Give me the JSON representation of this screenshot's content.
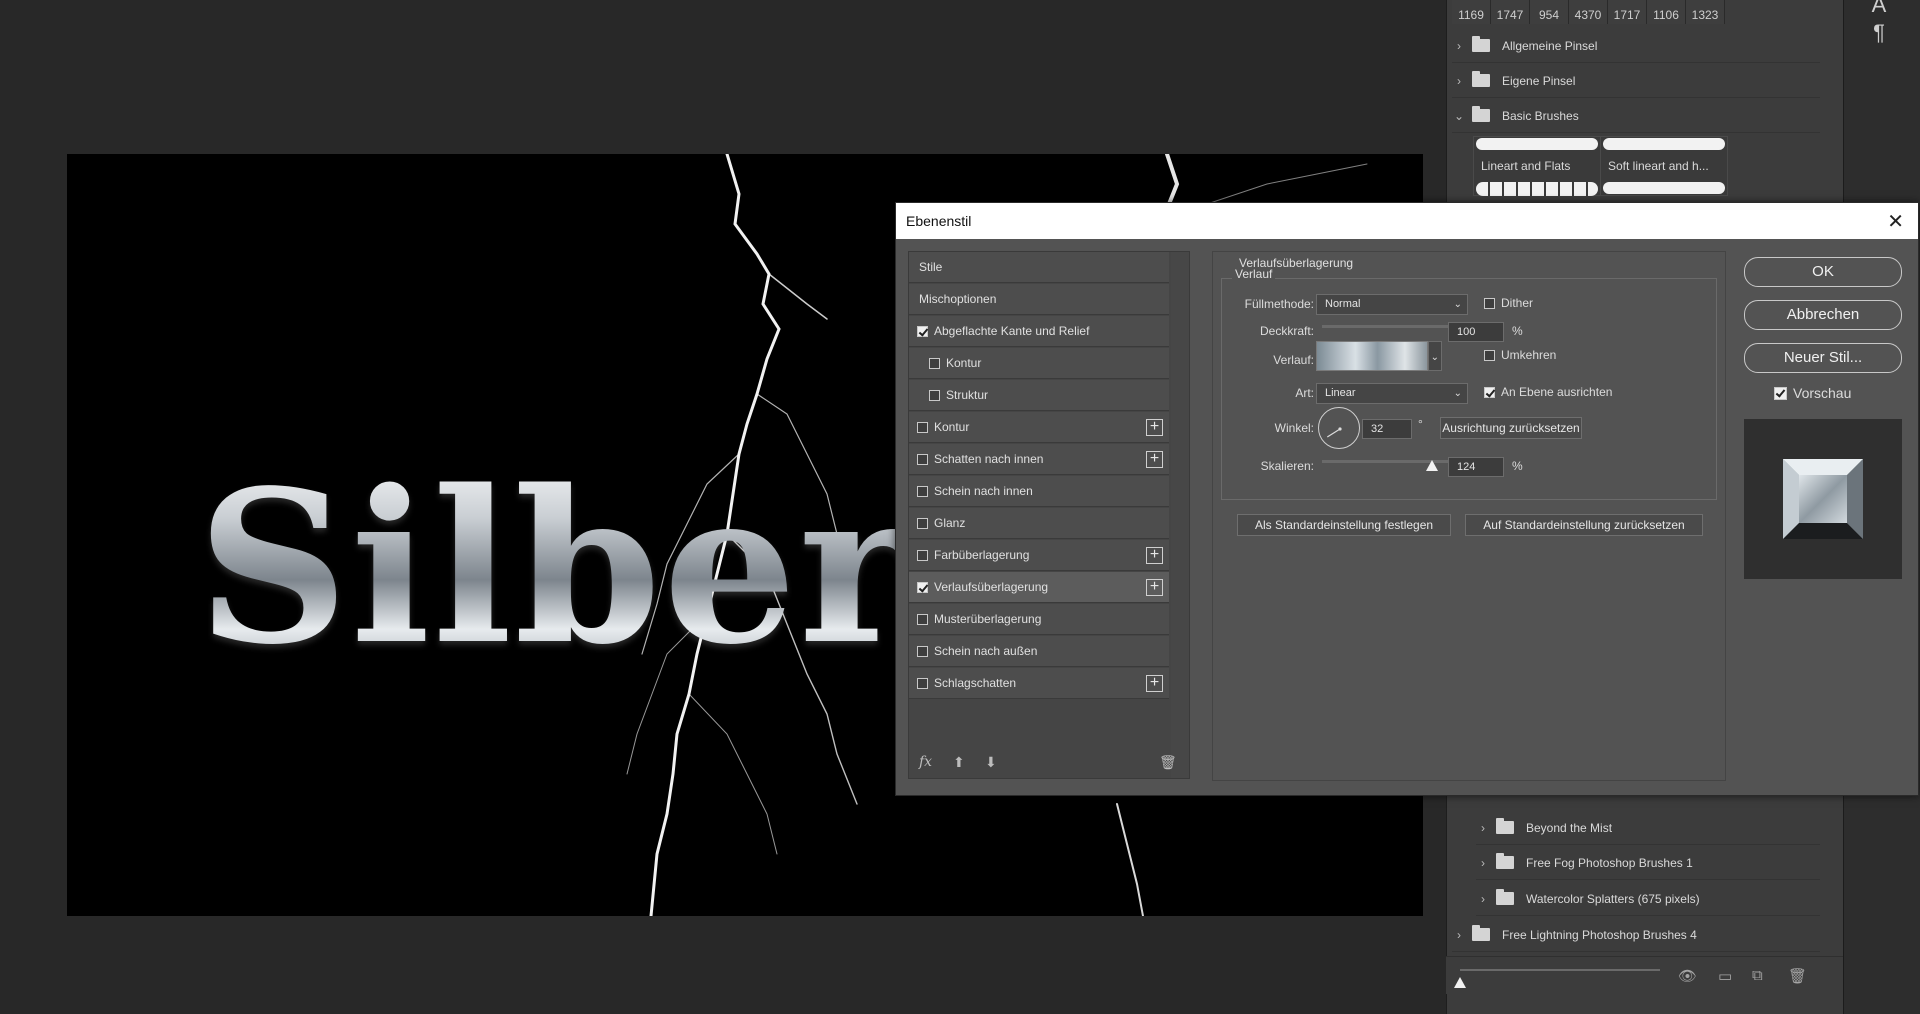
{
  "brush_panel": {
    "numbers": [
      "1169",
      "1747",
      "954",
      "4370",
      "1717",
      "1106",
      "1323"
    ],
    "folders_top": [
      "Allgemeine Pinsel",
      "Eigene Pinsel",
      "Basic Brushes"
    ],
    "brushes": [
      "Lineart and Flats",
      "Soft lineart and h..."
    ],
    "folders_bottom": [
      "Beyond the Mist",
      "Free Fog Photoshop Brushes 1",
      "Watercolor Splatters (675 pixels)",
      "Free Lightning Photoshop Brushes 4"
    ]
  },
  "canvas": {
    "text": "Silber"
  },
  "dialog": {
    "title": "Ebenenstil",
    "styles": {
      "head_stile": "Stile",
      "head_misch": "Mischoptionen",
      "bevel": "Abgeflachte Kante und Relief",
      "kontur_sub": "Kontur",
      "struktur": "Struktur",
      "kontur": "Kontur",
      "schatten_innen": "Schatten nach innen",
      "schein_innen": "Schein nach innen",
      "glanz": "Glanz",
      "farb": "Farbüberlagerung",
      "verlauf": "Verlaufsüberlagerung",
      "muster": "Musterüberlagerung",
      "schein_aussen": "Schein nach außen",
      "schlag": "Schlagschatten"
    },
    "footer_fx": "fx",
    "content": {
      "section_title": "Verlaufsüberlagerung",
      "group_title": "Verlauf",
      "fuellmethode_label": "Füllmethode:",
      "fuellmethode_value": "Normal",
      "dither_label": "Dither",
      "deckkraft_label": "Deckkraft:",
      "deckkraft_value": "100",
      "opacity_fraction": 1.0,
      "percent": "%",
      "verlauf_label": "Verlauf:",
      "umkehren_label": "Umkehren",
      "art_label": "Art:",
      "art_value": "Linear",
      "ausrichten_label": "An Ebene ausrichten",
      "winkel_label": "Winkel:",
      "winkel_value": "32",
      "degree": "°",
      "reset_align_button": "Ausrichtung zurücksetzen",
      "skalieren_label": "Skalieren:",
      "skalieren_value": "124",
      "scale_fraction": 0.8,
      "set_default_button": "Als Standardeinstellung festlegen",
      "reset_default_button": "Auf Standardeinstellung zurücksetzen"
    },
    "actions": {
      "ok": "OK",
      "cancel": "Abbrechen",
      "new_style": "Neuer Stil...",
      "preview_label": "Vorschau"
    }
  }
}
